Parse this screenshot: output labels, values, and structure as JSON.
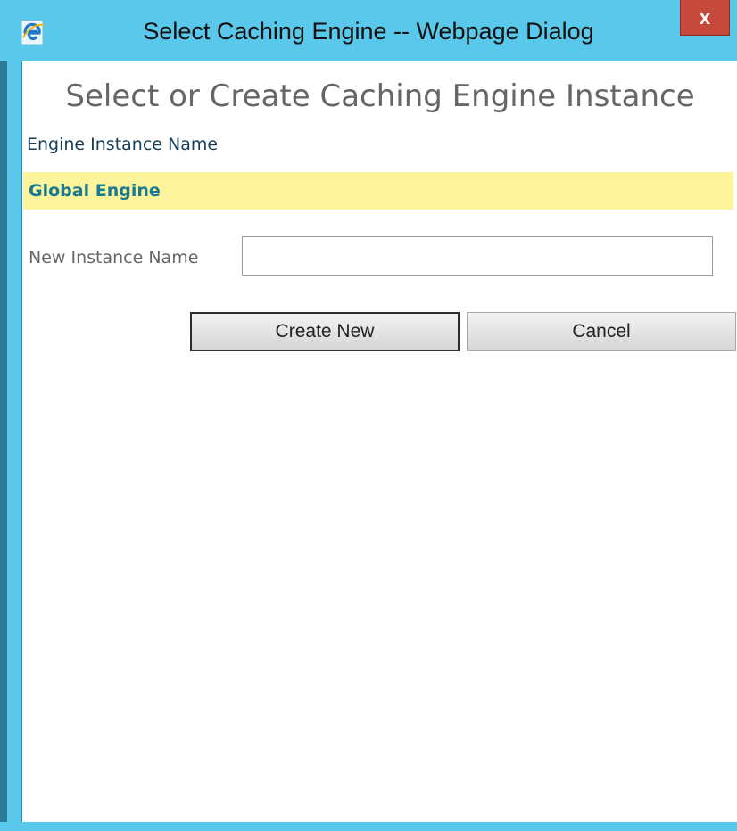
{
  "window": {
    "title": "Select Caching Engine -- Webpage Dialog",
    "close_label": "x",
    "icon": "ie-icon"
  },
  "dialog": {
    "heading": "Select or Create Caching Engine Instance",
    "list_header": "Engine Instance Name",
    "instances": [
      "Global Engine"
    ],
    "new_instance_label": "New Instance Name",
    "new_instance_value": "",
    "new_instance_placeholder": "",
    "create_label": "Create New",
    "cancel_label": "Cancel"
  },
  "colors": {
    "frame": "#5ac8ea",
    "close_button": "#c7493b",
    "selected_row": "#fdf49b",
    "instance_text": "#1a7a8f"
  }
}
